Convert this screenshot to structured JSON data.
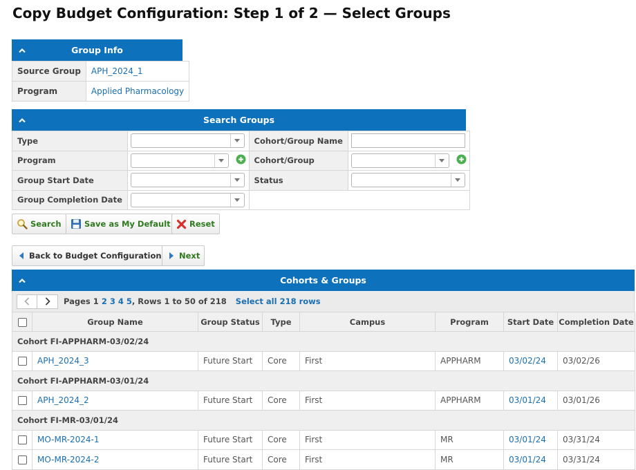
{
  "page": {
    "title": "Copy Budget Configuration: Step 1 of 2 — Select Groups"
  },
  "group_info": {
    "header": "Group Info",
    "rows": [
      {
        "label": "Source Group",
        "value": "APH_2024_1"
      },
      {
        "label": "Program",
        "value": "Applied Pharmacology"
      }
    ]
  },
  "search_groups": {
    "header": "Search Groups",
    "labels": {
      "type": "Type",
      "cohort_group_name": "Cohort/Group Name",
      "program": "Program",
      "cohort_group": "Cohort/Group",
      "group_start_date": "Group Start Date",
      "status": "Status",
      "group_completion_date": "Group Completion Date"
    },
    "values": {
      "type": "",
      "cohort_group_name": "",
      "program": "",
      "cohort_group": "",
      "group_start_date": "",
      "status": "",
      "group_completion_date": ""
    }
  },
  "actions": {
    "search": "Search",
    "save_default": "Save as My Default",
    "reset": "Reset",
    "back": "Back to Budget Configuration",
    "next": "Next"
  },
  "cohorts": {
    "header": "Cohorts & Groups",
    "pager": {
      "pages_prefix": "Pages",
      "current_page": "1",
      "page_links": "2 3 4 5",
      "rows_text": ", Rows 1 to 50 of 218",
      "select_all": "Select all 218 rows"
    },
    "columns": [
      "Group Name",
      "Group Status",
      "Type",
      "Campus",
      "Program",
      "Start Date",
      "Completion Date"
    ],
    "sections": [
      {
        "cohort": "Cohort FI-APPHARM-03/02/24",
        "rows": [
          {
            "name": "APH_2024_3",
            "status": "Future Start",
            "type": "Core",
            "campus": "First",
            "program": "APPHARM",
            "start": "03/02/24",
            "completion": "03/02/26"
          }
        ]
      },
      {
        "cohort": "Cohort FI-APPHARM-03/01/24",
        "rows": [
          {
            "name": "APH_2024_2",
            "status": "Future Start",
            "type": "Core",
            "campus": "First",
            "program": "APPHARM",
            "start": "03/01/24",
            "completion": "03/01/26"
          }
        ]
      },
      {
        "cohort": "Cohort FI-MR-03/01/24",
        "rows": [
          {
            "name": "MO-MR-2024-1",
            "status": "Future Start",
            "type": "Core",
            "campus": "First",
            "program": "MR",
            "start": "03/01/24",
            "completion": "03/31/24"
          },
          {
            "name": "MO-MR-2024-2",
            "status": "Future Start",
            "type": "Core",
            "campus": "First",
            "program": "MR",
            "start": "03/01/24",
            "completion": "03/31/24"
          }
        ]
      }
    ]
  },
  "colors": {
    "header_blue": "#0d71bb",
    "link_blue": "#1a6fb3",
    "button_green": "#2f7a1f"
  }
}
